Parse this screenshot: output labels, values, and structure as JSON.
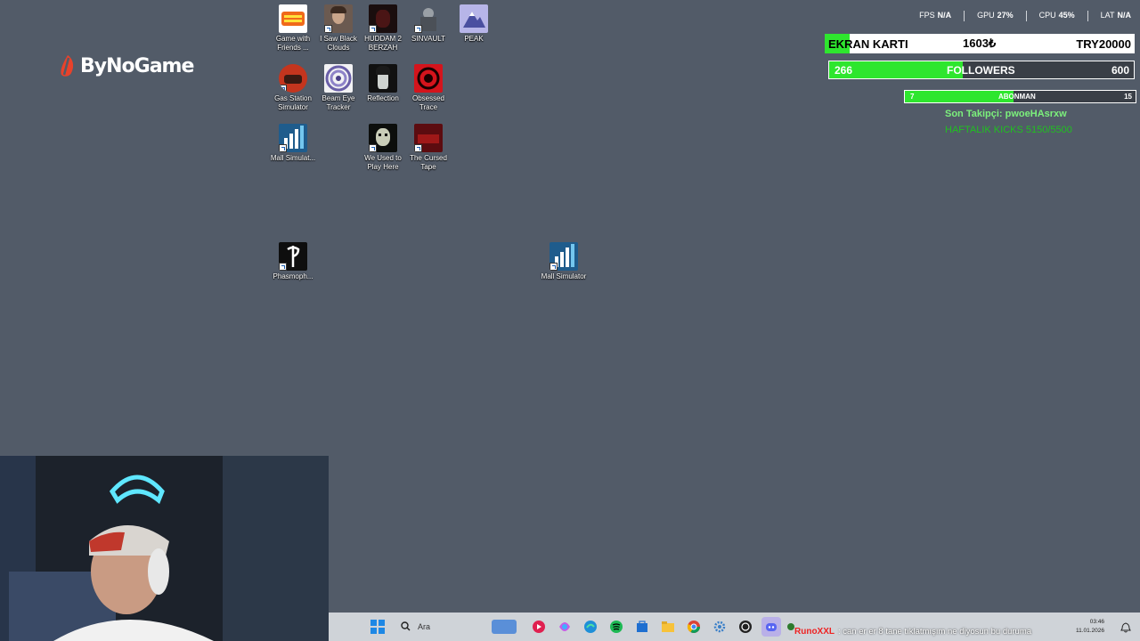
{
  "logo": {
    "text": "ByNoGame"
  },
  "desktop_icons": [
    {
      "label": "Game with Friends ...",
      "icon": "game-with-friends-icon"
    },
    {
      "label": "I Saw Black Clouds",
      "icon": "i-saw-black-clouds-icon"
    },
    {
      "label": "HUDDAM 2 BERZAH",
      "icon": "huddam-2-icon"
    },
    {
      "label": "SINVAULT",
      "icon": "sinvault-icon"
    },
    {
      "label": "PEAK",
      "icon": "peak-icon"
    },
    {
      "label": "Gas Station Simulator",
      "icon": "gas-station-simulator-icon"
    },
    {
      "label": "Beam Eye Tracker",
      "icon": "beam-eye-tracker-icon"
    },
    {
      "label": "Reflection",
      "icon": "reflection-icon"
    },
    {
      "label": "Obsessed Trace",
      "icon": "obsessed-trace-icon"
    },
    {
      "label": "Mall Simulat...",
      "icon": "mall-simulator-icon"
    },
    {
      "label": "We Used to Play Here",
      "icon": "we-used-to-play-here-icon"
    },
    {
      "label": "The Cursed Tape",
      "icon": "cursed-tape-icon"
    },
    {
      "label": "Phasmoph...",
      "icon": "phasmophobia-icon"
    },
    {
      "label": "Mall Simulator",
      "icon": "mall-simulator-icon"
    }
  ],
  "stats": {
    "fps_label": "FPS",
    "fps_value": "N/A",
    "gpu_label": "GPU",
    "gpu_value": "27%",
    "cpu_label": "CPU",
    "cpu_value": "45%",
    "lat_label": "LAT",
    "lat_value": "N/A"
  },
  "goals": {
    "gpu": {
      "title": "EKRAN KARTI",
      "current": "1603₺",
      "target": "TRY20000",
      "progress": 0.08
    },
    "followers": {
      "current": "266",
      "title": "FOLLOWERS",
      "target": "600",
      "progress": 0.44
    },
    "subs": {
      "current": "7",
      "title": "ABONMAN",
      "target": "15",
      "progress": 0.47
    }
  },
  "last_follower": "Son Takipçi: pwoeHAsrxw",
  "weekly_kicks": "HAFTALIK KICKS 5150/5500",
  "taskbar": {
    "search_placeholder": "Ara",
    "chat_user": "RunoXXL",
    "chat_message": ": can er er 8 tane tıklatmışım ne diyosun bu duruma",
    "time": "03:46",
    "date": "11.01.2026"
  },
  "colors": {
    "desktop": "#525b68",
    "accent_green": "#2ee62e",
    "taskbar": "#cfd3d8"
  }
}
